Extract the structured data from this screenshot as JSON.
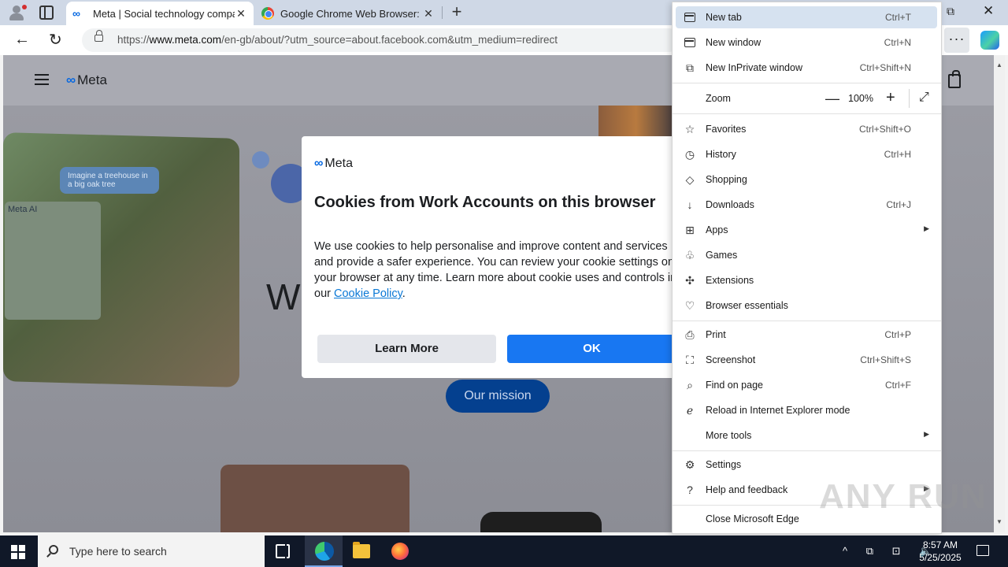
{
  "browser": {
    "tabs": [
      {
        "title": "Meta | Social technology company",
        "active": true
      },
      {
        "title": "Google Chrome Web Browser: Fi",
        "active": false
      }
    ],
    "address": {
      "prefix": "https://",
      "host": "www.meta.com",
      "path": "/en-gb/about/?utm_source=about.facebook.com&utm_medium=redirect"
    },
    "more_glyph": "···"
  },
  "site": {
    "logo": "Meta",
    "hero_prompt": "Imagine a treehouse in a big oak tree",
    "hero_metaai": "Meta AI",
    "hero_partial_text": "W",
    "cta": "Our mission"
  },
  "dialog": {
    "logo": "Meta",
    "title": "Cookies from Work Accounts on this browser",
    "body": "We use cookies to help personalise and improve content and services and provide a safer experience. You can review your cookie settings on your browser at any time. Learn more about cookie uses and controls in our ",
    "link": "Cookie Policy",
    "link_suffix": ".",
    "learn_more": "Learn More",
    "ok": "OK"
  },
  "menu": {
    "new_tab": {
      "label": "New tab",
      "shortcut": "Ctrl+T"
    },
    "new_window": {
      "label": "New window",
      "shortcut": "Ctrl+N"
    },
    "inprivate": {
      "label": "New InPrivate window",
      "shortcut": "Ctrl+Shift+N"
    },
    "zoom": {
      "label": "Zoom",
      "value": "100%",
      "minus": "—",
      "plus": "+"
    },
    "favorites": {
      "label": "Favorites",
      "shortcut": "Ctrl+Shift+O"
    },
    "history": {
      "label": "History",
      "shortcut": "Ctrl+H"
    },
    "shopping": {
      "label": "Shopping"
    },
    "downloads": {
      "label": "Downloads",
      "shortcut": "Ctrl+J"
    },
    "apps": {
      "label": "Apps"
    },
    "games": {
      "label": "Games"
    },
    "extensions": {
      "label": "Extensions"
    },
    "essentials": {
      "label": "Browser essentials"
    },
    "print": {
      "label": "Print",
      "shortcut": "Ctrl+P"
    },
    "screenshot": {
      "label": "Screenshot",
      "shortcut": "Ctrl+Shift+S"
    },
    "find": {
      "label": "Find on page",
      "shortcut": "Ctrl+F"
    },
    "ie_mode": {
      "label": "Reload in Internet Explorer mode"
    },
    "more_tools": {
      "label": "More tools"
    },
    "settings": {
      "label": "Settings"
    },
    "help": {
      "label": "Help and feedback"
    },
    "close": {
      "label": "Close Microsoft Edge"
    }
  },
  "watermark": "ANY RUN",
  "taskbar": {
    "search_placeholder": "Type here to search",
    "time": "8:57 AM",
    "date": "5/25/2025",
    "tray_glyphs": "^ ⧉ ⊡ 🔈"
  }
}
